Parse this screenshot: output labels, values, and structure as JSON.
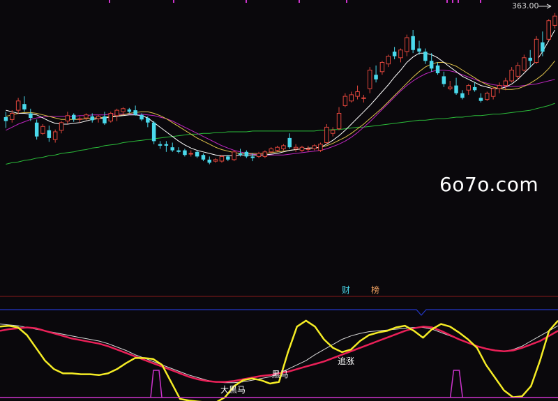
{
  "watermark": "6o7o.com",
  "badges": {
    "cai": "财",
    "bang": "榜"
  },
  "colors": {
    "background": "#0a080c",
    "up": "#e2463c",
    "down": "#4ad9ec",
    "ma_white": "#ffffff",
    "ma_yellow": "#e0c34a",
    "ma_magenta": "#c126c3",
    "ma_green": "#2bbd3a",
    "osc_yellow": "#f5ec25",
    "osc_red": "#ea2058",
    "osc_white": "#d8d8d8",
    "osc_blue": "#2437c8",
    "signal": "#cc33cc",
    "separator": "#8a1a1a"
  },
  "chart_data": [
    {
      "type": "candlestick",
      "max_label": "363.00",
      "ylim": [
        62,
        372
      ],
      "candles": [
        {
          "o": 231,
          "h": 238,
          "l": 217,
          "c": 226
        },
        {
          "o": 228,
          "h": 240,
          "l": 224,
          "c": 236
        },
        {
          "o": 240,
          "h": 256,
          "l": 235,
          "c": 252
        },
        {
          "o": 248,
          "h": 258,
          "l": 238,
          "c": 241
        },
        {
          "o": 236,
          "h": 242,
          "l": 226,
          "c": 230
        },
        {
          "o": 224,
          "h": 228,
          "l": 202,
          "c": 206
        },
        {
          "o": 210,
          "h": 222,
          "l": 208,
          "c": 219
        },
        {
          "o": 214,
          "h": 220,
          "l": 199,
          "c": 204
        },
        {
          "o": 202,
          "h": 215,
          "l": 198,
          "c": 212
        },
        {
          "o": 214,
          "h": 226,
          "l": 210,
          "c": 224
        },
        {
          "o": 226,
          "h": 238,
          "l": 222,
          "c": 233
        },
        {
          "o": 234,
          "h": 236,
          "l": 225,
          "c": 228
        },
        {
          "o": 228,
          "h": 232,
          "l": 224,
          "c": 229
        },
        {
          "o": 230,
          "h": 236,
          "l": 227,
          "c": 234
        },
        {
          "o": 232,
          "h": 236,
          "l": 224,
          "c": 227
        },
        {
          "o": 229,
          "h": 234,
          "l": 224,
          "c": 232
        },
        {
          "o": 232,
          "h": 238,
          "l": 221,
          "c": 223
        },
        {
          "o": 226,
          "h": 238,
          "l": 224,
          "c": 236
        },
        {
          "o": 233,
          "h": 242,
          "l": 226,
          "c": 240
        },
        {
          "o": 238,
          "h": 244,
          "l": 234,
          "c": 242
        },
        {
          "o": 241,
          "h": 243,
          "l": 236,
          "c": 238
        },
        {
          "o": 240,
          "h": 246,
          "l": 233,
          "c": 234
        },
        {
          "o": 234,
          "h": 236,
          "l": 226,
          "c": 228
        },
        {
          "o": 230,
          "h": 232,
          "l": 218,
          "c": 224
        },
        {
          "o": 224,
          "h": 226,
          "l": 196,
          "c": 200
        },
        {
          "o": 196,
          "h": 200,
          "l": 190,
          "c": 194
        },
        {
          "o": 196,
          "h": 200,
          "l": 186,
          "c": 194
        },
        {
          "o": 192,
          "h": 198,
          "l": 186,
          "c": 188
        },
        {
          "o": 188,
          "h": 192,
          "l": 184,
          "c": 186
        },
        {
          "o": 188,
          "h": 190,
          "l": 180,
          "c": 182
        },
        {
          "o": 184,
          "h": 188,
          "l": 180,
          "c": 184
        },
        {
          "o": 186,
          "h": 188,
          "l": 178,
          "c": 180
        },
        {
          "o": 182,
          "h": 184,
          "l": 174,
          "c": 176
        },
        {
          "o": 176,
          "h": 180,
          "l": 170,
          "c": 172
        },
        {
          "o": 174,
          "h": 178,
          "l": 172,
          "c": 176
        },
        {
          "o": 174,
          "h": 182,
          "l": 172,
          "c": 180
        },
        {
          "o": 180,
          "h": 182,
          "l": 174,
          "c": 176
        },
        {
          "o": 176,
          "h": 188,
          "l": 174,
          "c": 186
        },
        {
          "o": 184,
          "h": 190,
          "l": 180,
          "c": 182
        },
        {
          "o": 186,
          "h": 188,
          "l": 178,
          "c": 180
        },
        {
          "o": 180,
          "h": 184,
          "l": 174,
          "c": 178
        },
        {
          "o": 180,
          "h": 186,
          "l": 178,
          "c": 184
        },
        {
          "o": 180,
          "h": 188,
          "l": 178,
          "c": 186
        },
        {
          "o": 186,
          "h": 192,
          "l": 184,
          "c": 190
        },
        {
          "o": 188,
          "h": 194,
          "l": 186,
          "c": 192
        },
        {
          "o": 190,
          "h": 196,
          "l": 188,
          "c": 194
        },
        {
          "o": 204,
          "h": 210,
          "l": 190,
          "c": 192
        },
        {
          "o": 190,
          "h": 196,
          "l": 186,
          "c": 192
        },
        {
          "o": 188,
          "h": 194,
          "l": 186,
          "c": 192
        },
        {
          "o": 190,
          "h": 194,
          "l": 186,
          "c": 190
        },
        {
          "o": 190,
          "h": 196,
          "l": 188,
          "c": 194
        },
        {
          "o": 188,
          "h": 198,
          "l": 186,
          "c": 196
        },
        {
          "o": 198,
          "h": 222,
          "l": 196,
          "c": 218
        },
        {
          "o": 210,
          "h": 218,
          "l": 206,
          "c": 214
        },
        {
          "o": 216,
          "h": 244,
          "l": 214,
          "c": 236
        },
        {
          "o": 246,
          "h": 262,
          "l": 244,
          "c": 258
        },
        {
          "o": 252,
          "h": 264,
          "l": 250,
          "c": 260
        },
        {
          "o": 258,
          "h": 272,
          "l": 254,
          "c": 264
        },
        {
          "o": 256,
          "h": 260,
          "l": 250,
          "c": 256
        },
        {
          "o": 268,
          "h": 296,
          "l": 262,
          "c": 292
        },
        {
          "o": 286,
          "h": 298,
          "l": 276,
          "c": 280
        },
        {
          "o": 290,
          "h": 304,
          "l": 286,
          "c": 302
        },
        {
          "o": 300,
          "h": 312,
          "l": 296,
          "c": 310
        },
        {
          "o": 316,
          "h": 322,
          "l": 306,
          "c": 310
        },
        {
          "o": 308,
          "h": 320,
          "l": 302,
          "c": 318
        },
        {
          "o": 316,
          "h": 338,
          "l": 310,
          "c": 334
        },
        {
          "o": 336,
          "h": 344,
          "l": 314,
          "c": 318
        },
        {
          "o": 320,
          "h": 330,
          "l": 312,
          "c": 316
        },
        {
          "o": 316,
          "h": 320,
          "l": 300,
          "c": 304
        },
        {
          "o": 304,
          "h": 314,
          "l": 290,
          "c": 294
        },
        {
          "o": 298,
          "h": 302,
          "l": 286,
          "c": 288
        },
        {
          "o": 284,
          "h": 290,
          "l": 270,
          "c": 274
        },
        {
          "o": 268,
          "h": 278,
          "l": 266,
          "c": 270
        },
        {
          "o": 272,
          "h": 282,
          "l": 260,
          "c": 262
        },
        {
          "o": 262,
          "h": 266,
          "l": 254,
          "c": 256
        },
        {
          "o": 266,
          "h": 274,
          "l": 260,
          "c": 272
        },
        {
          "o": 270,
          "h": 276,
          "l": 264,
          "c": 266
        },
        {
          "o": 256,
          "h": 262,
          "l": 250,
          "c": 252
        },
        {
          "o": 254,
          "h": 264,
          "l": 252,
          "c": 262
        },
        {
          "o": 258,
          "h": 270,
          "l": 254,
          "c": 268
        },
        {
          "o": 268,
          "h": 276,
          "l": 262,
          "c": 272
        },
        {
          "o": 272,
          "h": 282,
          "l": 266,
          "c": 278
        },
        {
          "o": 278,
          "h": 296,
          "l": 276,
          "c": 292
        },
        {
          "o": 284,
          "h": 302,
          "l": 280,
          "c": 298
        },
        {
          "o": 292,
          "h": 312,
          "l": 290,
          "c": 308
        },
        {
          "o": 308,
          "h": 318,
          "l": 296,
          "c": 304
        },
        {
          "o": 302,
          "h": 336,
          "l": 300,
          "c": 332
        },
        {
          "o": 328,
          "h": 342,
          "l": 310,
          "c": 316
        },
        {
          "o": 332,
          "h": 358,
          "l": 330,
          "c": 356
        },
        {
          "o": 350,
          "h": 366,
          "l": 346,
          "c": 362
        }
      ],
      "ma_white": [
        240,
        238,
        236,
        236,
        235,
        234,
        230,
        226,
        223,
        222,
        222,
        223,
        224,
        226,
        228,
        229,
        230,
        231,
        232,
        233,
        234,
        234,
        233,
        230,
        224,
        218,
        212,
        206,
        200,
        195,
        191,
        188,
        186,
        184,
        182,
        181,
        181,
        181,
        182,
        182,
        182,
        182,
        182,
        183,
        184,
        186,
        188,
        189,
        190,
        191,
        191,
        192,
        196,
        201,
        207,
        214,
        222,
        230,
        238,
        246,
        255,
        264,
        273,
        283,
        292,
        302,
        309,
        314,
        314,
        312,
        308,
        302,
        296,
        290,
        284,
        280,
        276,
        272,
        270,
        268,
        268,
        270,
        274,
        280,
        288,
        296,
        304,
        316,
        330,
        344
      ],
      "ma_yellow": [
        232,
        234,
        236,
        237,
        237,
        236,
        234,
        232,
        230,
        228,
        228,
        228,
        228,
        229,
        230,
        230,
        231,
        232,
        233,
        234,
        236,
        237,
        238,
        238,
        236,
        233,
        229,
        224,
        219,
        214,
        209,
        204,
        200,
        196,
        192,
        189,
        187,
        185,
        184,
        184,
        184,
        184,
        184,
        185,
        186,
        187,
        188,
        189,
        190,
        191,
        191,
        192,
        194,
        197,
        201,
        205,
        210,
        216,
        222,
        229,
        236,
        243,
        251,
        259,
        267,
        275,
        283,
        290,
        296,
        300,
        302,
        302,
        300,
        297,
        292,
        287,
        282,
        277,
        273,
        270,
        268,
        267,
        267,
        268,
        271,
        275,
        280,
        286,
        294,
        304
      ],
      "ma_magenta": [
        214,
        218,
        222,
        225,
        228,
        230,
        231,
        232,
        232,
        232,
        232,
        232,
        233,
        233,
        234,
        234,
        234,
        235,
        235,
        235,
        235,
        235,
        235,
        234,
        233,
        231,
        229,
        226,
        222,
        218,
        214,
        210,
        206,
        202,
        198,
        194,
        191,
        188,
        186,
        184,
        183,
        182,
        182,
        182,
        182,
        182,
        183,
        184,
        185,
        186,
        187,
        188,
        190,
        193,
        196,
        200,
        205,
        211,
        218,
        225,
        233,
        241,
        249,
        257,
        265,
        272,
        278,
        283,
        287,
        290,
        292,
        292,
        291,
        289,
        286,
        283,
        280,
        277,
        275,
        273,
        272,
        271,
        271,
        271,
        272,
        273,
        274,
        276,
        278,
        280
      ],
      "ma_green": [
        170,
        172,
        173,
        175,
        176,
        178,
        179,
        181,
        182,
        184,
        185,
        186,
        188,
        189,
        191,
        192,
        194,
        195,
        196,
        198,
        199,
        200,
        201,
        202,
        203,
        204,
        205,
        206,
        207,
        208,
        209,
        209,
        210,
        210,
        211,
        211,
        212,
        212,
        212,
        212,
        213,
        213,
        213,
        213,
        213,
        213,
        213,
        213,
        213,
        213,
        213,
        214,
        214,
        215,
        215,
        216,
        217,
        218,
        218,
        219,
        220,
        221,
        222,
        223,
        224,
        225,
        226,
        227,
        227,
        228,
        229,
        229,
        230,
        231,
        231,
        232,
        233,
        233,
        234,
        235,
        235,
        236,
        237,
        238,
        239,
        240,
        242,
        244,
        246,
        249
      ]
    },
    {
      "type": "line",
      "ylim": [
        0,
        100
      ],
      "series_yellow": [
        85,
        86,
        84,
        75,
        60,
        45,
        35,
        30,
        30,
        29,
        29,
        28,
        30,
        35,
        42,
        48,
        48,
        47,
        40,
        20,
        0,
        -2,
        -3,
        -4,
        -4,
        2,
        15,
        22,
        24,
        22,
        18,
        20,
        55,
        85,
        92,
        85,
        70,
        60,
        55,
        58,
        68,
        75,
        78,
        80,
        84,
        86,
        80,
        72,
        82,
        88,
        85,
        78,
        70,
        60,
        40,
        25,
        10,
        2,
        3,
        15,
        45,
        80,
        92
      ],
      "series_red": [
        80,
        82,
        83,
        84,
        83,
        80,
        77,
        74,
        71,
        69,
        67,
        65,
        62,
        58,
        54,
        50,
        46,
        42,
        38,
        34,
        30,
        26,
        23,
        21,
        20,
        20,
        21,
        23,
        25,
        27,
        28,
        30,
        32,
        35,
        38,
        41,
        44,
        48,
        52,
        56,
        60,
        64,
        68,
        72,
        76,
        80,
        83,
        85,
        84,
        80,
        75,
        70,
        66,
        62,
        59,
        57,
        56,
        57,
        60,
        64,
        68,
        74,
        80
      ],
      "series_white": [
        88,
        87,
        86,
        84,
        82,
        80,
        78,
        76,
        74,
        72,
        70,
        68,
        65,
        61,
        57,
        52,
        48,
        44,
        40,
        36,
        32,
        28,
        25,
        22,
        20,
        19,
        19,
        20,
        22,
        24,
        26,
        30,
        35,
        40,
        45,
        52,
        58,
        64,
        70,
        74,
        77,
        79,
        80,
        81,
        82,
        83,
        84,
        84,
        82,
        78,
        74,
        70,
        66,
        62,
        59,
        57,
        56,
        58,
        62,
        68,
        74,
        80,
        86
      ],
      "signal_1": {
        "x": [
          0.27,
          0.28,
          0.29
        ]
      },
      "signal_2": {
        "x": [
          0.807,
          0.818,
          0.829
        ]
      },
      "blue_dip_x": 0.755,
      "labels": [
        {
          "text": "大黑马",
          "xf": 0.395
        },
        {
          "text": "黑马",
          "xf": 0.487
        },
        {
          "text": "追涨",
          "xf": 0.605
        }
      ]
    }
  ]
}
